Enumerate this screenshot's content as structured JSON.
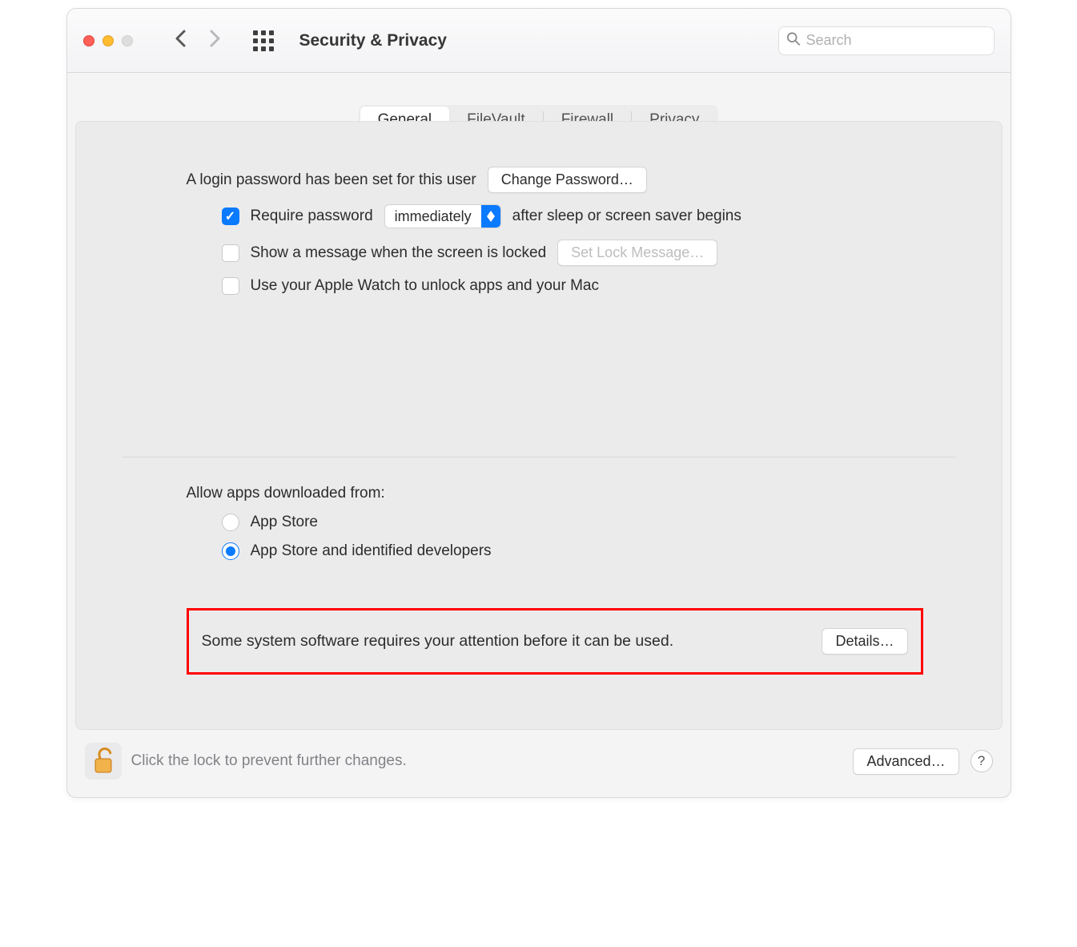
{
  "window": {
    "title": "Security & Privacy"
  },
  "search": {
    "placeholder": "Search"
  },
  "tabs": {
    "general": "General",
    "filevault": "FileVault",
    "firewall": "Firewall",
    "privacy": "Privacy",
    "active": "general"
  },
  "general": {
    "login_password_text": "A login password has been set for this user",
    "change_password_button": "Change Password…",
    "require_password_label_pre": "Require password",
    "require_password_select": "immediately",
    "require_password_label_post": "after sleep or screen saver begins",
    "show_message_label": "Show a message when the screen is locked",
    "set_lock_message_button": "Set Lock Message…",
    "apple_watch_label": "Use your Apple Watch to unlock apps and your Mac",
    "allow_apps_heading": "Allow apps downloaded from:",
    "radio_app_store": "App Store",
    "radio_identified": "App Store and identified developers",
    "attention_text": "Some system software requires your attention before it can be used.",
    "details_button": "Details…"
  },
  "footer": {
    "lock_text": "Click the lock to prevent further changes.",
    "advanced_button": "Advanced…",
    "help": "?"
  }
}
